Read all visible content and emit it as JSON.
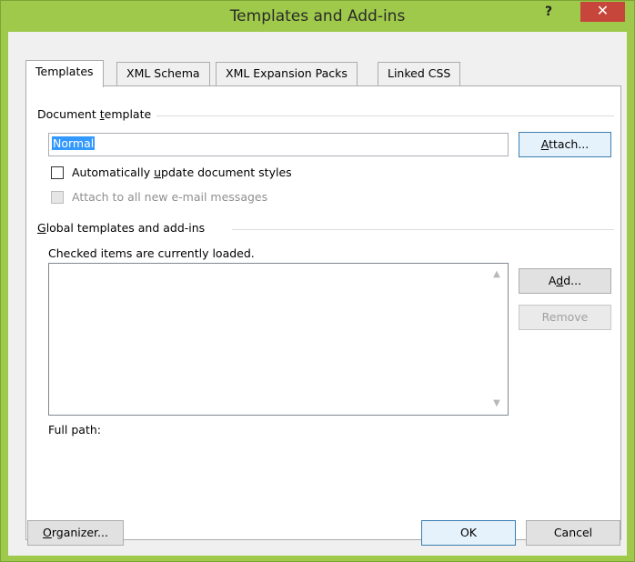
{
  "window": {
    "title": "Templates and Add-ins",
    "help_label": "?",
    "close_label": "✕"
  },
  "tabs": [
    {
      "label": "Templates",
      "active": true
    },
    {
      "label": "XML Schema",
      "active": false
    },
    {
      "label": "XML Expansion Packs",
      "active": false
    },
    {
      "label": "Linked CSS",
      "active": false
    }
  ],
  "document_template": {
    "group_label_pre": "Document ",
    "group_label_key": "t",
    "group_label_post": "emplate",
    "value": "Normal",
    "attach_pre": "",
    "attach_key": "A",
    "attach_post": "ttach...",
    "auto_update_pre": "Automatically ",
    "auto_update_key": "u",
    "auto_update_post": "pdate document styles",
    "auto_update_checked": false,
    "attach_email": "Attach to all new e-mail messages",
    "attach_email_checked": false
  },
  "global_templates": {
    "group_label_pre": "",
    "group_label_key": "G",
    "group_label_post": "lobal templates and add-ins",
    "hint": "Checked items are currently loaded.",
    "add_pre": "A",
    "add_key": "d",
    "add_post": "d...",
    "remove_label": "Remove",
    "full_path_label": "Full path:"
  },
  "footer": {
    "organizer_pre": "",
    "organizer_key": "O",
    "organizer_post": "rganizer...",
    "ok_label": "OK",
    "cancel_label": "Cancel"
  },
  "colors": {
    "title_bar": "#9ec94a",
    "close_button": "#c7463b",
    "selection": "#3399ff"
  }
}
